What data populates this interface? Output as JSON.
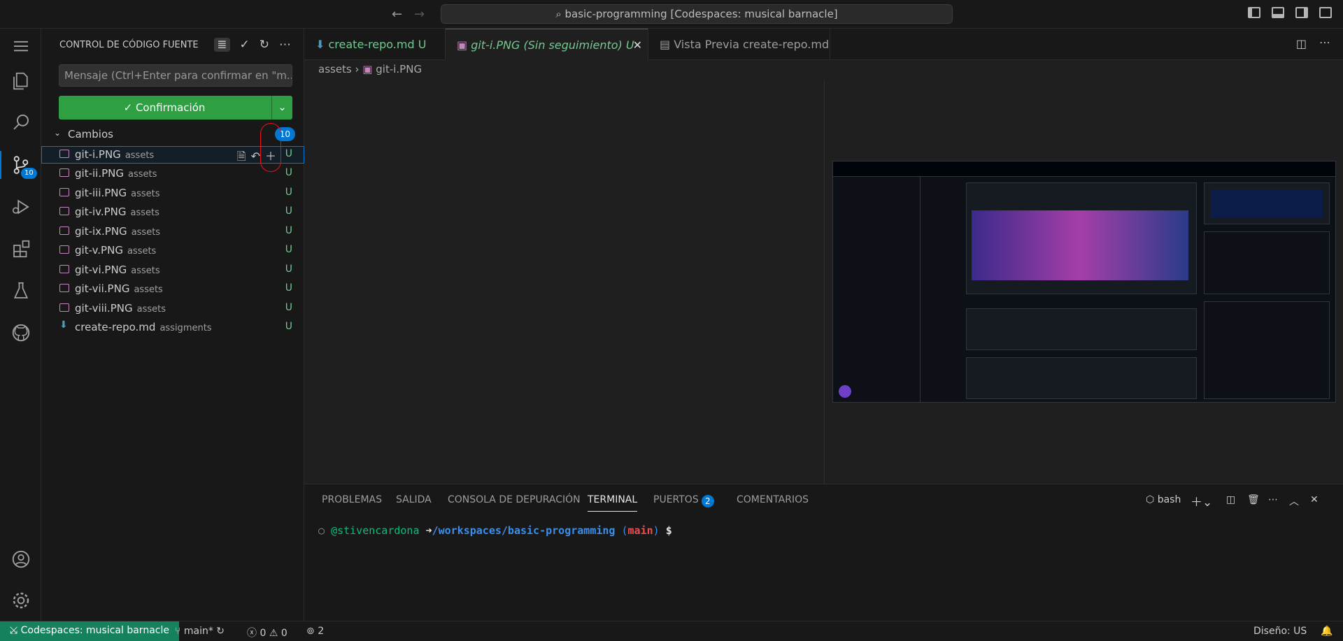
{
  "titlebar": {
    "back_icon": "←",
    "forward_icon": "→",
    "command_center": "basic-programming [Codespaces: musical barnacle]"
  },
  "activitybar": {
    "scm_badge": "10"
  },
  "sidebar": {
    "title": "CONTROL DE CÓDIGO FUENTE",
    "commit_message_placeholder": "Mensaje (Ctrl+Enter para confirmar en \"m...",
    "commit_button": "✓ Confirmación",
    "changes_label": "Cambios",
    "changes_count": "10",
    "files": [
      {
        "name": "git-i.PNG",
        "dir": "assets",
        "status": "U"
      },
      {
        "name": "git-ii.PNG",
        "dir": "assets",
        "status": "U"
      },
      {
        "name": "git-iii.PNG",
        "dir": "assets",
        "status": "U"
      },
      {
        "name": "git-iv.PNG",
        "dir": "assets",
        "status": "U"
      },
      {
        "name": "git-ix.PNG",
        "dir": "assets",
        "status": "U"
      },
      {
        "name": "git-v.PNG",
        "dir": "assets",
        "status": "U"
      },
      {
        "name": "git-vi.PNG",
        "dir": "assets",
        "status": "U"
      },
      {
        "name": "git-vii.PNG",
        "dir": "assets",
        "status": "U"
      },
      {
        "name": "git-viii.PNG",
        "dir": "assets",
        "status": "U"
      },
      {
        "name": "create-repo.md",
        "dir": "assigments",
        "status": "U"
      }
    ]
  },
  "tabs": [
    {
      "label": "create-repo.md",
      "suffix": "U"
    },
    {
      "label": "git-i.PNG (Sin seguimiento)",
      "suffix": "U"
    },
    {
      "label": "Vista Previa create-repo.md",
      "suffix": ""
    }
  ],
  "breadcrumb": {
    "folder": "assets",
    "file": "git-i.PNG"
  },
  "panel": {
    "tabs": [
      "PROBLEMAS",
      "SALIDA",
      "CONSOLA DE DEPURACIÓN",
      "TERMINAL",
      "PUERTOS",
      "COMENTARIOS"
    ],
    "ports_badge": "2",
    "shell": "bash",
    "terminal": {
      "user": "@stivencardona",
      "arrow": "➜",
      "path": "/workspaces/basic-programming",
      "branch_open": "(",
      "branch": "main",
      "branch_close": ")",
      "prompt": "$"
    }
  },
  "status": {
    "remote": "Codespaces: musical barnacle",
    "branch": "main*",
    "errors": "0",
    "warnings": "0",
    "ports": "2",
    "layout": "Diseño: US"
  },
  "colors": {
    "accent": "#0078d4",
    "commit_green": "#2ea043",
    "untracked": "#73c991",
    "remote_bg": "#16825d"
  }
}
